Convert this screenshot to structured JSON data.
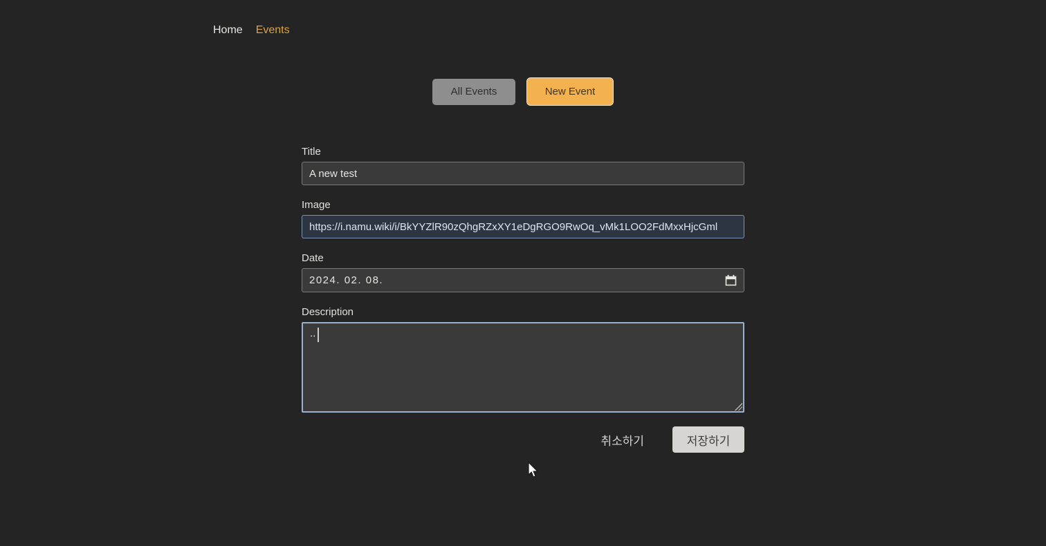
{
  "nav": {
    "home_label": "Home",
    "events_label": "Events"
  },
  "tabs": {
    "all_events_label": "All Events",
    "new_event_label": "New Event"
  },
  "form": {
    "title_label": "Title",
    "title_value": "A new test",
    "image_label": "Image",
    "image_value": "https://i.namu.wiki/i/BkYYZlR90zQhgRZxXY1eDgRGO9RwOq_vMk1LOO2FdMxxHjcGml",
    "date_label": "Date",
    "date_value": "2024. 02. 08.",
    "description_label": "Description",
    "description_value": "..",
    "cancel_label": "취소하기",
    "save_label": "저장하기"
  },
  "colors": {
    "page_background": "#242424",
    "nav_active_orange": "#dda23d",
    "all_events_button_bg": "#8e8e8e",
    "new_event_button_bg": "#f3b14f",
    "input_bg": "#3a3a3a",
    "input_border": "#7a7a7a",
    "image_input_bg": "#2c3541",
    "image_input_border": "#7b95b4",
    "focused_border_blue": "#9cb3cf",
    "save_button_bg": "#d7d5d2"
  },
  "icons": {
    "calendar": "calendar-icon",
    "textarea_resize": "resize-handle",
    "pointer": "mouse-cursor-arrow"
  }
}
